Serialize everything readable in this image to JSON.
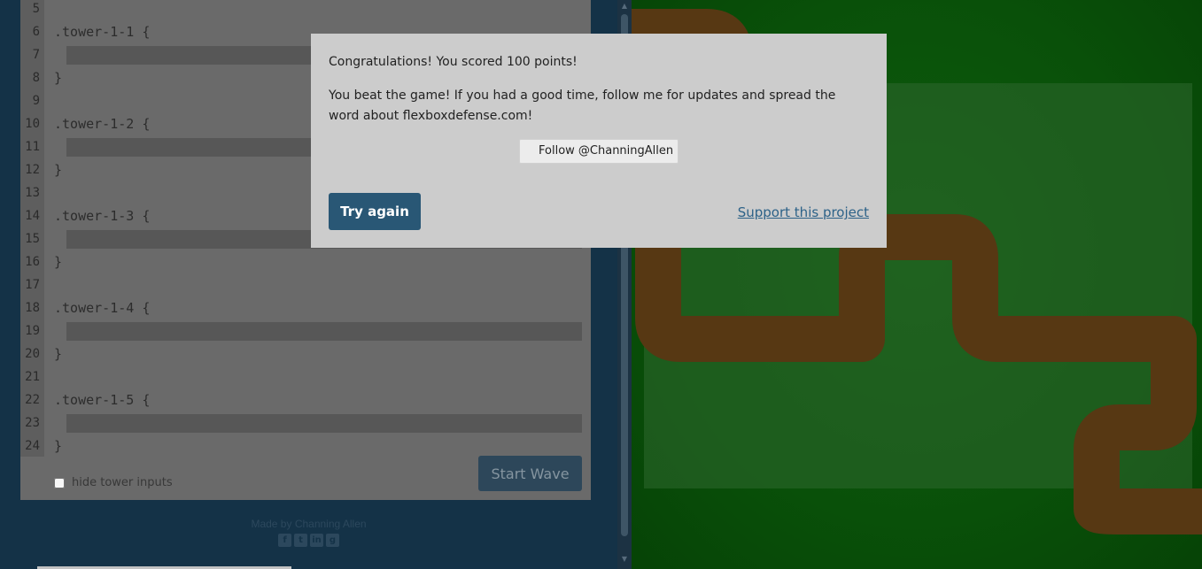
{
  "editor": {
    "lines": [
      {
        "num": "5",
        "text": ""
      },
      {
        "num": "6",
        "text": ".tower-1-1 {"
      },
      {
        "num": "7",
        "input": true,
        "value": ""
      },
      {
        "num": "8",
        "text": "}"
      },
      {
        "num": "9",
        "text": ""
      },
      {
        "num": "10",
        "text": ".tower-1-2 {"
      },
      {
        "num": "11",
        "input": true,
        "value": ""
      },
      {
        "num": "12",
        "text": "}"
      },
      {
        "num": "13",
        "text": ""
      },
      {
        "num": "14",
        "text": ".tower-1-3 {"
      },
      {
        "num": "15",
        "input": true,
        "value": ""
      },
      {
        "num": "16",
        "text": "}"
      },
      {
        "num": "17",
        "text": ""
      },
      {
        "num": "18",
        "text": ".tower-1-4 {"
      },
      {
        "num": "19",
        "input": true,
        "value": ""
      },
      {
        "num": "20",
        "text": "}"
      },
      {
        "num": "21",
        "text": ""
      },
      {
        "num": "22",
        "text": ".tower-1-5 {"
      },
      {
        "num": "23",
        "input": true,
        "value": ""
      },
      {
        "num": "24",
        "text": "}"
      }
    ],
    "hide_inputs_label": "hide tower inputs",
    "hide_inputs_checked": false,
    "start_wave_label": "Start Wave"
  },
  "footer": {
    "made_by": "Made by Channing Allen",
    "social_icons": [
      "facebook-icon",
      "twitter-icon",
      "linkedin-icon",
      "github-icon"
    ]
  },
  "board": {
    "grass_color": "#0b5a0b",
    "path_color": "#5a3a14",
    "zone_color": "#2f6b2f"
  },
  "modal": {
    "score_text": "Congratulations! You scored 100 points!",
    "message": "You beat the game! If you had a good time, follow me for updates and spread the word about flexboxdefense.com!",
    "follow_label": "Follow @ChanningAllen",
    "try_again_label": "Try again",
    "support_label": "Support this project",
    "button_color": "#295775",
    "link_color": "#2d6288"
  },
  "scrollbar": {
    "up_icon": "▲",
    "down_icon": "▼"
  }
}
